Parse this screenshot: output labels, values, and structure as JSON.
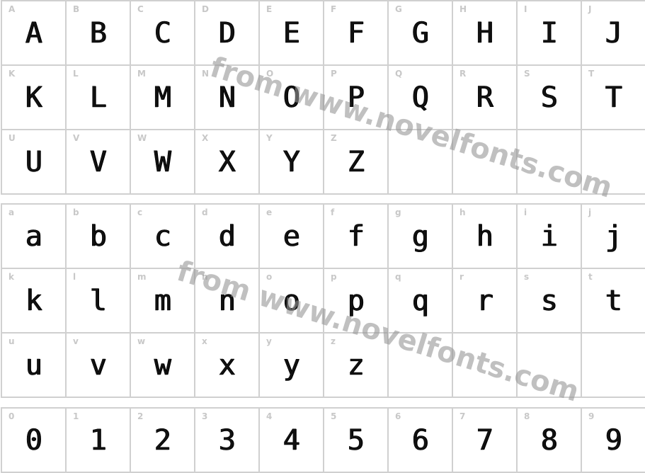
{
  "uppercase": [
    "A",
    "B",
    "C",
    "D",
    "E",
    "F",
    "G",
    "H",
    "I",
    "J",
    "K",
    "L",
    "M",
    "N",
    "O",
    "P",
    "Q",
    "R",
    "S",
    "T",
    "U",
    "V",
    "W",
    "X",
    "Y",
    "Z"
  ],
  "lowercase": [
    "a",
    "b",
    "c",
    "d",
    "e",
    "f",
    "g",
    "h",
    "i",
    "j",
    "k",
    "l",
    "m",
    "n",
    "o",
    "p",
    "q",
    "r",
    "s",
    "t",
    "u",
    "v",
    "w",
    "x",
    "y",
    "z"
  ],
  "digits": [
    "0",
    "1",
    "2",
    "3",
    "4",
    "5",
    "6",
    "7",
    "8",
    "9"
  ],
  "watermark": "from www.novelfonts.com"
}
